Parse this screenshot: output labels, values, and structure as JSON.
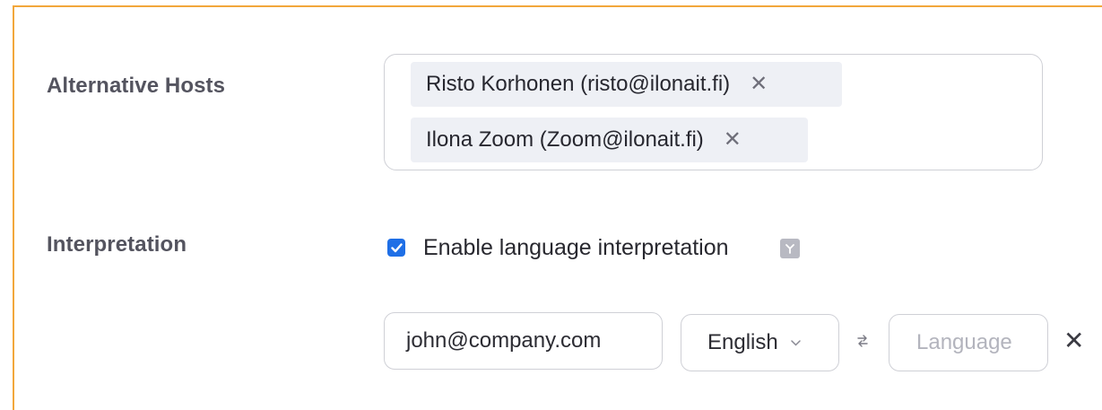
{
  "alternative_hosts": {
    "label": "Alternative Hosts",
    "chips": [
      {
        "text": "Risto Korhonen (risto@ilonait.fi)",
        "remove": "✕"
      },
      {
        "text": "Ilona Zoom (Zoom@ilonait.fi)",
        "remove": "✕"
      }
    ]
  },
  "interpretation": {
    "label": "Interpretation",
    "checkbox_checked": true,
    "checkbox_label": "Enable language interpretation",
    "interpreter_email": "john@company.com",
    "language_from": "English",
    "language_to_placeholder": "Language",
    "remove": "✕"
  },
  "colors": {
    "accent_border": "#f2a73b",
    "checkbox": "#1f6fe6",
    "chip_bg": "#eef0f5"
  },
  "icons": [
    "close-icon",
    "chevron-down-icon",
    "swap-icon",
    "help-icon",
    "checkmark-icon"
  ]
}
